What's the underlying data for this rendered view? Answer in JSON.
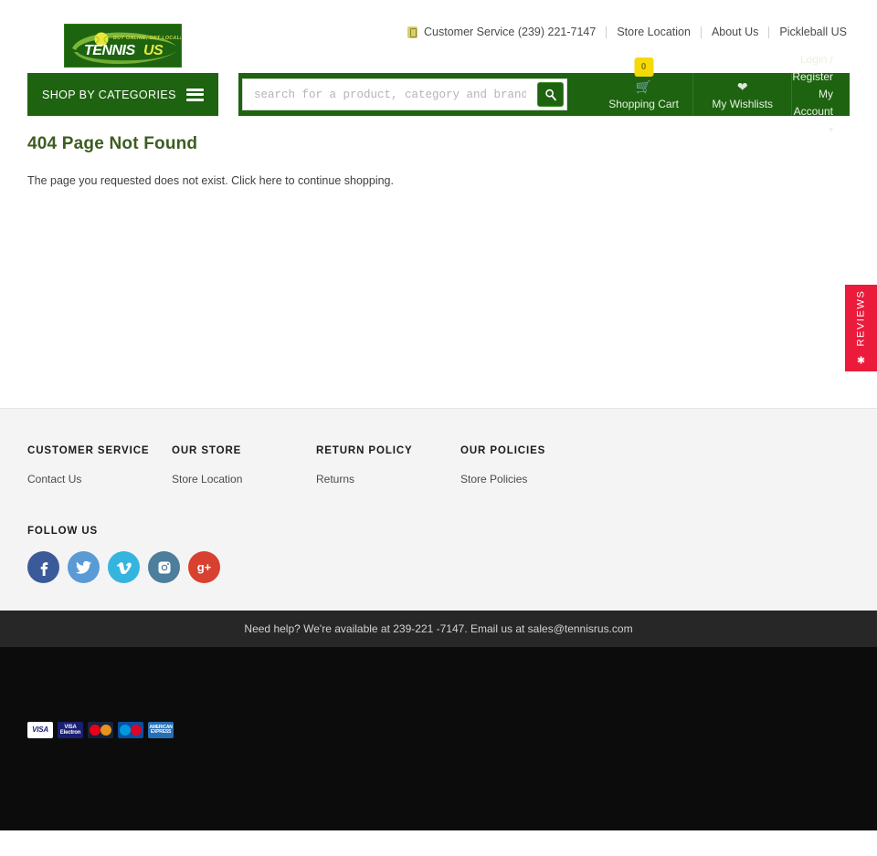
{
  "topnav": {
    "customer_service": "Customer Service (239) 221-7147",
    "phone_icon": "phone-icon",
    "links": [
      {
        "label": "Store Location"
      },
      {
        "label": "About Us"
      },
      {
        "label": "Pickleball US"
      }
    ]
  },
  "logo": {
    "tagline": "BUY ONLINE, GET LOCALLY!",
    "name_primary": "TENNIS",
    "name_secondary": "US",
    "alt": "Tennis US"
  },
  "header": {
    "shop_by_categories": "SHOP BY CATEGORIES",
    "menu_icon": "hamburger-menu-icon",
    "search": {
      "placeholder": "search for a product, category and brand",
      "value": "",
      "button_icon": "search-icon"
    },
    "cart": {
      "label": "Shopping Cart",
      "icon": "shopping-cart-icon",
      "badge": "0"
    },
    "wishlist": {
      "label": "My Wishlists",
      "icon": "heart-icon"
    },
    "account": {
      "login_label": "Login / Register",
      "account_label": "My Account",
      "caret_icon": "chevron-down-icon"
    }
  },
  "main": {
    "title": "404 Page Not Found",
    "body_before": "The page you requested does not exist. Click ",
    "body_link": "here",
    "body_after": " to continue shopping."
  },
  "reviews_tab": {
    "label": "REVIEWS",
    "star_icon": "star-icon",
    "color": "#eb1b3c"
  },
  "footer": {
    "columns": [
      {
        "title": "CUSTOMER SERVICE",
        "links": [
          {
            "label": "Contact Us"
          }
        ]
      },
      {
        "title": "OUR STORE",
        "links": [
          {
            "label": "Store Location"
          }
        ]
      },
      {
        "title": "RETURN POLICY",
        "links": [
          {
            "label": "Returns"
          }
        ]
      },
      {
        "title": "OUR POLICIES",
        "links": [
          {
            "label": "Store Policies"
          }
        ]
      }
    ],
    "follow_title": "FOLLOW US",
    "socials": [
      {
        "name": "facebook",
        "glyph": "f",
        "color": "#3b5a9a",
        "icon": "facebook-icon"
      },
      {
        "name": "twitter",
        "glyph": "t",
        "color": "#5b9bd5",
        "icon": "twitter-icon"
      },
      {
        "name": "vimeo",
        "glyph": "v",
        "color": "#35b4e0",
        "icon": "vimeo-icon"
      },
      {
        "name": "instagram",
        "glyph": "i",
        "color": "#4d7e9c",
        "icon": "instagram-icon"
      },
      {
        "name": "googleplus",
        "glyph": "g+",
        "color": "#d8402f",
        "icon": "google-plus-icon"
      }
    ],
    "help_text": "Need help? We're available at 239-221 -7147. Email us at sales@tennisrus.com",
    "payments": [
      {
        "label": "VISA",
        "name": "visa"
      },
      {
        "label": "VISA Electron",
        "name": "visa-electron"
      },
      {
        "label": "MasterCard",
        "name": "mastercard"
      },
      {
        "label": "Maestro",
        "name": "maestro"
      },
      {
        "label": "AMERICAN EXPRESS",
        "name": "american-express"
      }
    ],
    "corner_mark": "."
  }
}
